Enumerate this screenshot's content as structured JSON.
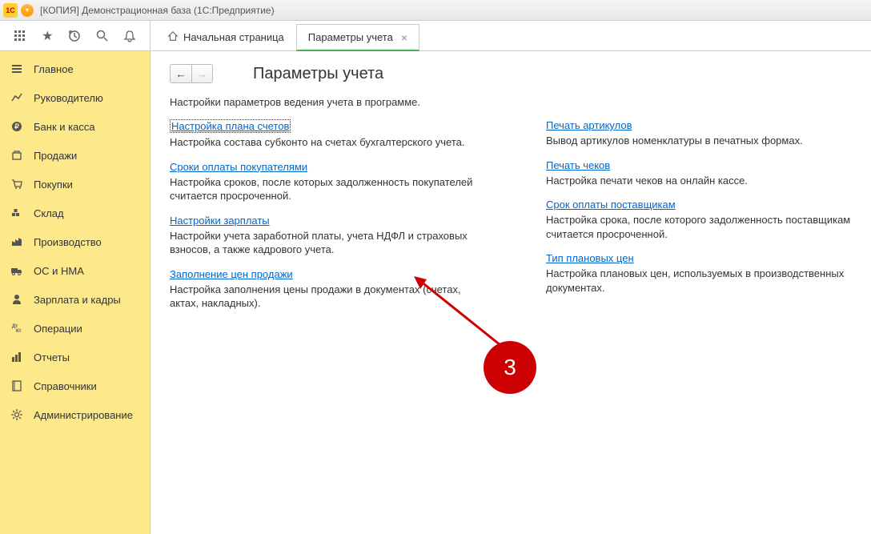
{
  "titlebar": {
    "text": "[КОПИЯ] Демонстрационная база  (1С:Предприятие)",
    "logo_text": "1C"
  },
  "tabs": {
    "home": "Начальная страница",
    "active": "Параметры учета"
  },
  "sidebar": {
    "items": [
      {
        "label": "Главное",
        "icon": "menu"
      },
      {
        "label": "Руководителю",
        "icon": "chart"
      },
      {
        "label": "Банк и касса",
        "icon": "bank"
      },
      {
        "label": "Продажи",
        "icon": "sales"
      },
      {
        "label": "Покупки",
        "icon": "cart"
      },
      {
        "label": "Склад",
        "icon": "warehouse"
      },
      {
        "label": "Производство",
        "icon": "factory"
      },
      {
        "label": "ОС и НМА",
        "icon": "truck"
      },
      {
        "label": "Зарплата и кадры",
        "icon": "person"
      },
      {
        "label": "Операции",
        "icon": "ops"
      },
      {
        "label": "Отчеты",
        "icon": "reports"
      },
      {
        "label": "Справочники",
        "icon": "book"
      },
      {
        "label": "Администрирование",
        "icon": "gear"
      }
    ]
  },
  "content": {
    "title": "Параметры учета",
    "description": "Настройки параметров ведения учета в программе.",
    "left_col": [
      {
        "link": "Настройка плана счетов",
        "desc": "Настройка состава субконто на счетах бухгалтерского учета.",
        "selected": true
      },
      {
        "link": "Сроки оплаты покупателями",
        "desc": "Настройка сроков, после которых задолженность покупателей считается просроченной."
      },
      {
        "link": "Настройки зарплаты",
        "desc": "Настройки учета заработной платы, учета НДФЛ и страховых взносов, а также кадрового учета."
      },
      {
        "link": "Заполнение цен продажи",
        "desc": "Настройка заполнения цены продажи в документах (счетах, актах, накладных)."
      }
    ],
    "right_col": [
      {
        "link": "Печать артикулов",
        "desc": "Вывод артикулов номенклатуры в печатных формах."
      },
      {
        "link": "Печать чеков",
        "desc": "Настройка печати чеков на онлайн кассе."
      },
      {
        "link": "Срок оплаты поставщикам",
        "desc": "Настройка срока, после которого задолженность поставщикам считается просроченной."
      },
      {
        "link": "Тип плановых цен",
        "desc": "Настройка плановых цен, используемых в производственных документах."
      }
    ]
  },
  "annotation": {
    "number": "3"
  }
}
